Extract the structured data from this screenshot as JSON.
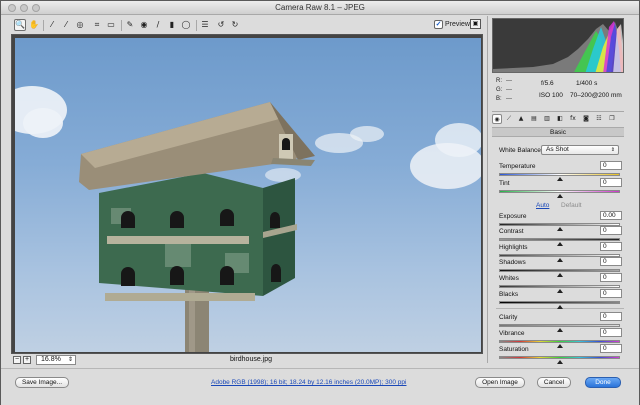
{
  "window": {
    "title": "Camera Raw 8.1  –  JPEG"
  },
  "toolbar": {
    "tools": [
      {
        "name": "zoom-tool",
        "glyph": "🔍"
      },
      {
        "name": "hand-tool",
        "glyph": "✋"
      },
      {
        "name": "white-balance-tool",
        "glyph": "⁄"
      },
      {
        "name": "color-sampler-tool",
        "glyph": "⁄"
      },
      {
        "name": "targeted-adjustment-tool",
        "glyph": "◎"
      },
      {
        "name": "crop-tool",
        "glyph": "⌗"
      },
      {
        "name": "straighten-tool",
        "glyph": "▭"
      },
      {
        "name": "spot-removal-tool",
        "glyph": "✎"
      },
      {
        "name": "red-eye-tool",
        "glyph": "◉"
      },
      {
        "name": "adjustment-brush-tool",
        "glyph": "/"
      },
      {
        "name": "graduated-filter-tool",
        "glyph": "▮"
      },
      {
        "name": "radial-filter-tool",
        "glyph": "◯"
      },
      {
        "name": "preferences-tool",
        "glyph": "☰"
      },
      {
        "name": "rotate-ccw-tool",
        "glyph": "↺"
      },
      {
        "name": "rotate-cw-tool",
        "glyph": "↻"
      }
    ],
    "preview_label": "Preview",
    "preview_checked": "✓"
  },
  "status": {
    "zoom_minus": "−",
    "zoom_plus": "+",
    "zoom": "16.8%",
    "zoom_arrow": "⇕",
    "filename": "birdhouse.jpg"
  },
  "info": {
    "r_label": "R:",
    "r_value": "---",
    "g_label": "G:",
    "g_value": "---",
    "b_label": "B:",
    "b_value": "---",
    "aperture": "f/5.6",
    "shutter": "1/400 s",
    "iso": "ISO 100",
    "lens": "70–200@200 mm"
  },
  "panel": {
    "tabs": [
      "◉",
      "⟋",
      "▲",
      "▤",
      "▥",
      "◧",
      "fx",
      "◙",
      "☷",
      "❐"
    ],
    "header": "Basic",
    "white_balance_label": "White Balance:",
    "white_balance_value": "As Shot",
    "white_balance_arrow": "⇕",
    "auto": "Auto",
    "default": "Default",
    "temperature": {
      "label": "Temperature",
      "value": "0",
      "level": 0.5
    },
    "tint": {
      "label": "Tint",
      "value": "0",
      "level": 0.5
    },
    "exposure": {
      "label": "Exposure",
      "value": "0.00",
      "level": 0.5
    },
    "contrast": {
      "label": "Contrast",
      "value": "0",
      "level": 0.5
    },
    "highlights": {
      "label": "Highlights",
      "value": "0",
      "level": 0.5
    },
    "shadows": {
      "label": "Shadows",
      "value": "0",
      "level": 0.5
    },
    "whites": {
      "label": "Whites",
      "value": "0",
      "level": 0.5
    },
    "blacks": {
      "label": "Blacks",
      "value": "0",
      "level": 0.5
    },
    "clarity": {
      "label": "Clarity",
      "value": "0",
      "level": 0.5
    },
    "vibrance": {
      "label": "Vibrance",
      "value": "0",
      "level": 0.5
    },
    "saturation": {
      "label": "Saturation",
      "value": "0",
      "level": 0.5
    }
  },
  "bottom": {
    "save_label": "Save Image...",
    "workflow_link": "Adobe RGB (1998); 16 bit; 18.24 by 12.16 inches (20.0MP); 300 ppi",
    "open_label": "Open Image",
    "cancel_label": "Cancel",
    "done_label": "Done"
  },
  "colors": {
    "accent": "#2a74d9",
    "link": "#1a48b8"
  }
}
